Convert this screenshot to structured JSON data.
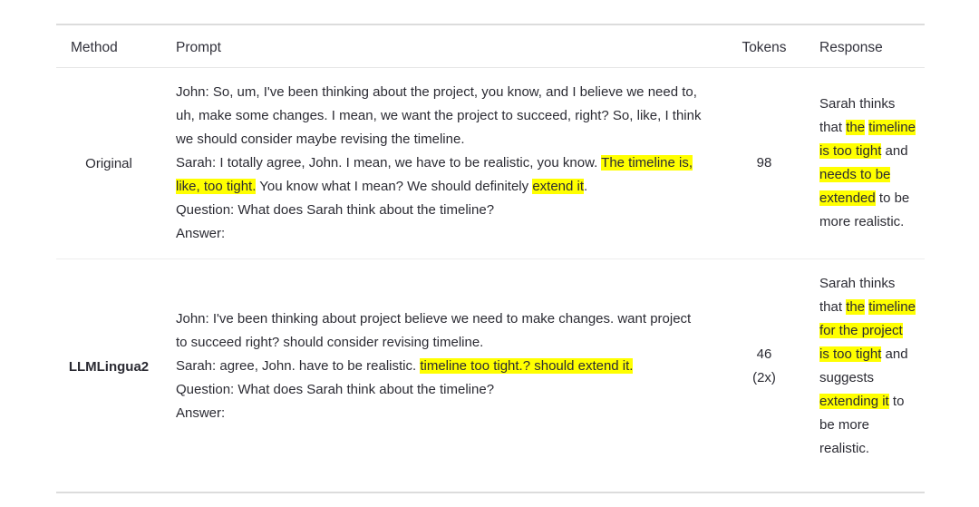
{
  "table": {
    "headers": {
      "method": "Method",
      "prompt": "Prompt",
      "tokens": "Tokens",
      "response": "Response"
    },
    "highlight_color": "#ffff00",
    "rule_color": "#dcdcdc",
    "rows": [
      {
        "method": "Original",
        "method_bold": false,
        "tokens": "98",
        "tokens_note": "",
        "prompt_lines": [
          "John: So, um, I've been thinking about the project, you know, and I believe we need to, uh, make some changes. I mean, we want the project to succeed, right? So, like, I think we should consider maybe revising the timeline.",
          "Sarah: I totally agree, John. I mean, we have to be realistic, you know. The timeline is, like, too tight. You know what I mean? We should definitely extend it.",
          "Question: What does Sarah think about the timeline?",
          "Answer:"
        ],
        "prompt_highlights": [
          "The timeline is, like, too tight.",
          "extend it"
        ],
        "response_text": "Sarah thinks that the timeline is too tight and needs to be extended to be more realistic.",
        "response_highlights": [
          "the",
          "timeline is too tight",
          "needs to be extended"
        ]
      },
      {
        "method": "LLMLingua2",
        "method_bold": true,
        "tokens": "46",
        "tokens_note": "(2x)",
        "prompt_lines": [
          "John: I've been thinking about project believe we need to make changes. want project to succeed right? should consider revising timeline.",
          "Sarah: agree, John. have to be realistic. timeline too tight.? should extend it.",
          "Question: What does Sarah think about the timeline?",
          "Answer:"
        ],
        "prompt_highlights": [
          "timeline too tight.? should extend it."
        ],
        "response_text": "Sarah thinks that the timeline for the project is too tight and suggests extending it to be more realistic.",
        "response_highlights": [
          "the",
          "timeline for the project is too tight",
          "extending it"
        ]
      }
    ]
  }
}
